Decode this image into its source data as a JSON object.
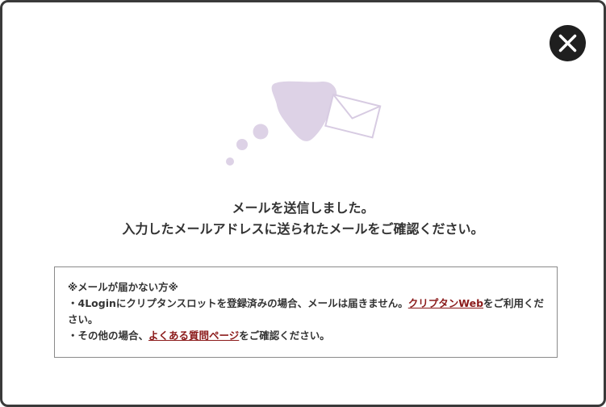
{
  "close_button": {
    "icon": "close-icon",
    "color": "#1f1f1f"
  },
  "illustration": {
    "icon": "mail-sent-illustration",
    "blob_color": "#ddd2e6",
    "envelope_color": "#d7cbe2"
  },
  "message": {
    "line1": "メールを送信しました。",
    "line2": "入力したメールアドレスに送られたメールをご確認ください。"
  },
  "notice": {
    "heading": "※メールが届かない方※",
    "item1_prefix": "・4Loginにクリプタンスロットを登録済みの場合、メールは届きません。",
    "item1_link": "クリプタンWeb",
    "item1_suffix": "をご利用ください。",
    "item2_prefix": "・その他の場合、",
    "item2_link": "よくある質問ページ",
    "item2_suffix": "をご確認ください。",
    "link_color": "#8b1a1a"
  }
}
